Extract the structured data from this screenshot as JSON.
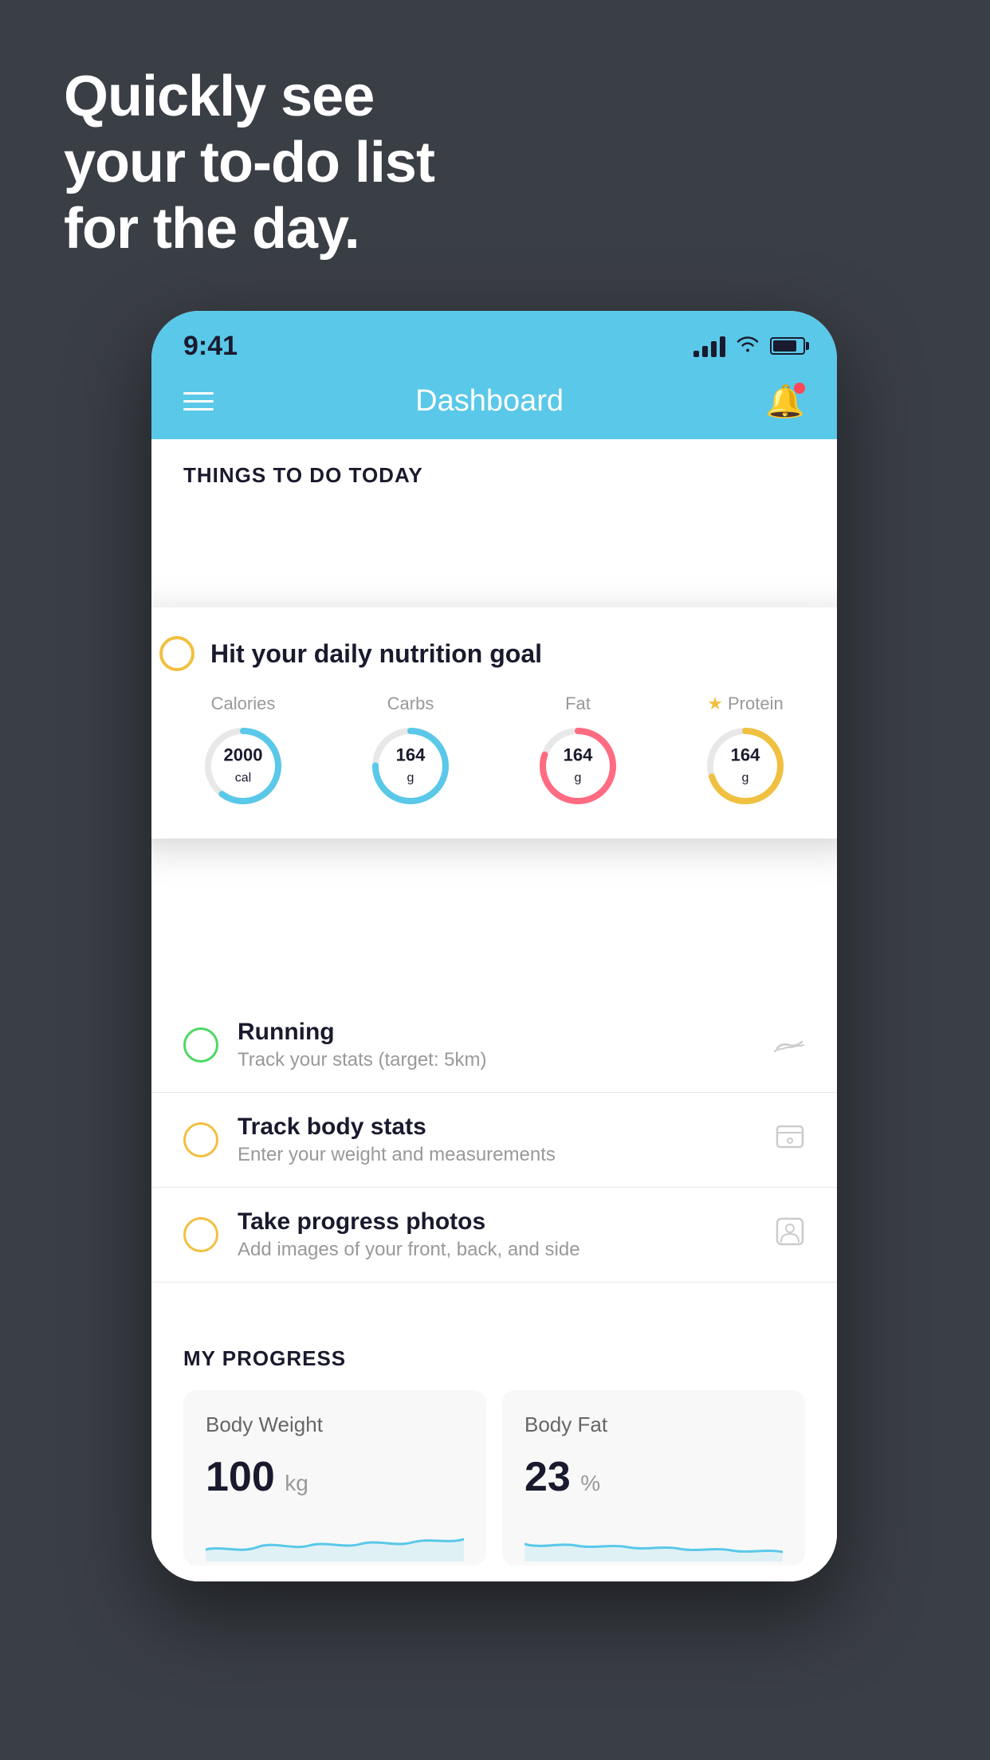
{
  "background_color": "#3a3e45",
  "hero": {
    "line1": "Quickly see",
    "line2": "your to-do list",
    "line3": "for the day."
  },
  "phone": {
    "status_bar": {
      "time": "9:41",
      "signal_bars": [
        0.4,
        0.6,
        0.8,
        1.0
      ],
      "battery_percent": 80
    },
    "nav": {
      "title": "Dashboard"
    },
    "section_header": "THINGS TO DO TODAY",
    "floating_card": {
      "title": "Hit your daily nutrition goal",
      "nutrition": [
        {
          "label": "Calories",
          "value": "2000",
          "unit": "cal",
          "color": "#5ac8e8",
          "percent": 60
        },
        {
          "label": "Carbs",
          "value": "164",
          "unit": "g",
          "color": "#5ac8e8",
          "percent": 75
        },
        {
          "label": "Fat",
          "value": "164",
          "unit": "g",
          "color": "#ff6b81",
          "percent": 80
        },
        {
          "label": "Protein",
          "value": "164",
          "unit": "g",
          "color": "#f0c040",
          "percent": 70,
          "starred": true
        }
      ]
    },
    "todo_items": [
      {
        "title": "Running",
        "subtitle": "Track your stats (target: 5km)",
        "circle_color": "green",
        "icon": "shoe"
      },
      {
        "title": "Track body stats",
        "subtitle": "Enter your weight and measurements",
        "circle_color": "yellow",
        "icon": "scale"
      },
      {
        "title": "Take progress photos",
        "subtitle": "Add images of your front, back, and side",
        "circle_color": "yellow",
        "icon": "person"
      }
    ],
    "progress_section": {
      "header": "MY PROGRESS",
      "cards": [
        {
          "title": "Body Weight",
          "value": "100",
          "unit": "kg"
        },
        {
          "title": "Body Fat",
          "value": "23",
          "unit": "%"
        }
      ]
    }
  }
}
